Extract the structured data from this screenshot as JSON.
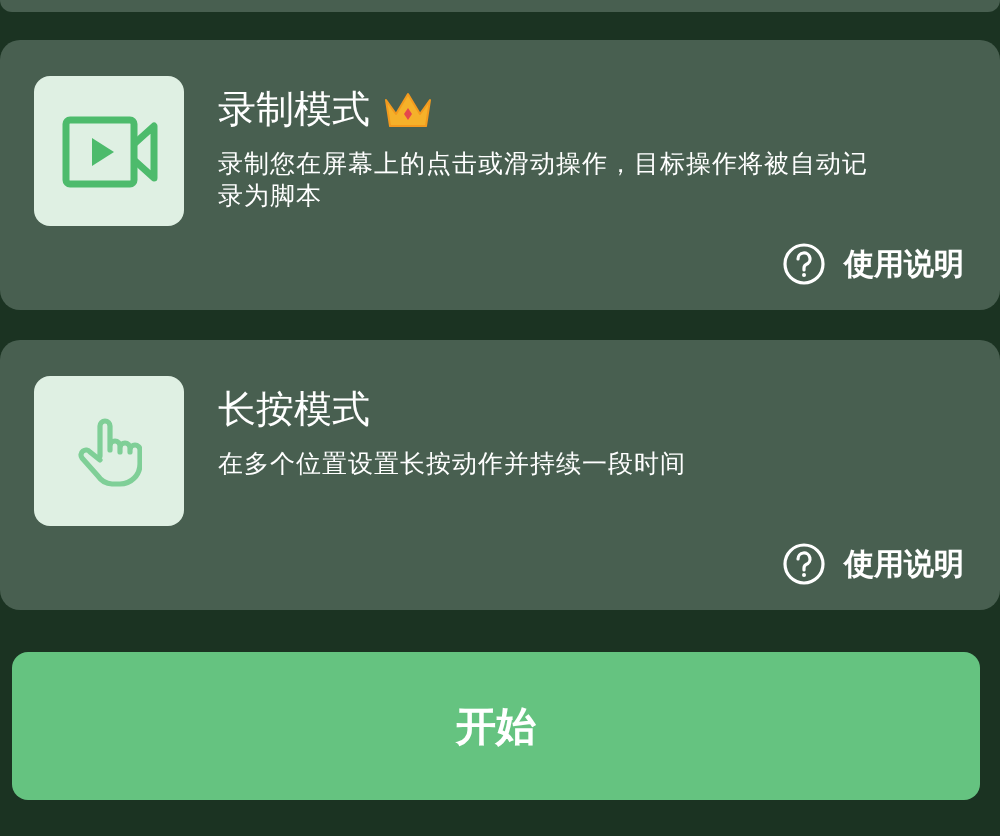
{
  "modes": [
    {
      "kind": "record",
      "title": "录制模式",
      "premium": true,
      "description": "录制您在屏幕上的点击或滑动操作，目标操作将被自动记录为脚本",
      "help": "使用说明"
    },
    {
      "kind": "longpress",
      "title": "长按模式",
      "premium": false,
      "description": "在多个位置设置长按动作并持续一段时间",
      "help": "使用说明"
    }
  ],
  "start_button": "开始"
}
